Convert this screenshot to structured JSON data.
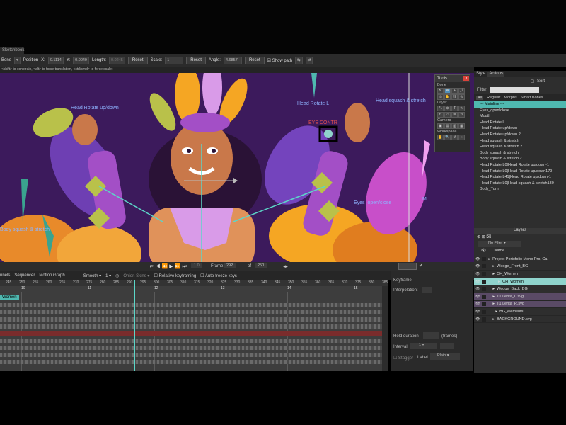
{
  "window": {
    "doc_tab": "Sketchbook"
  },
  "tool_options": {
    "tool": "Bone",
    "position_label": "Position",
    "x_label": "X:",
    "x_value": "0.1114",
    "y_label": "Y:",
    "y_value": "0.0049",
    "length_label": "Length:",
    "length_value": "0.0245",
    "reset1": "Reset",
    "scale_label": "Scale:",
    "scale_value": "1",
    "reset2": "Reset",
    "angle_label": "Angle:",
    "angle_value": "4.6857",
    "reset3": "Reset",
    "show_path": "Show path"
  },
  "hint": "<shift> to constrain, <alt> to force translation, <ctrl/cmd> to force scale)",
  "canvas": {
    "labels": {
      "head_rotate_updown": "Head Rotate up/down",
      "head_rotate_l": "Head Rotate L",
      "head_squash": "Head squash & stretch",
      "eye_control": "EYE CONTR",
      "eyes_open_close": "Eyes_open/close",
      "body_squash": "Body squash & stretch",
      "mi": "Mi"
    }
  },
  "tools_panel": {
    "title": "Tools",
    "close": "x",
    "sections": [
      "Bone",
      "Layer",
      "Camera",
      "Workspace"
    ]
  },
  "timeline": {
    "tabs": [
      "nnels",
      "Sequencer",
      "Motion Graph"
    ],
    "smooth": "Smooth",
    "one": "1",
    "onion": "Onion Skins",
    "relative": "Relative keyframing",
    "autofreeze": "Auto-freeze keys",
    "frame_label": "Frame:",
    "frame_value": "292",
    "of_label": "of",
    "of_value": "250",
    "frame_box": "1.0",
    "ruler": [
      "245",
      "250",
      "255",
      "260",
      "265",
      "270",
      "275",
      "280",
      "285",
      "290",
      "295",
      "300",
      "305",
      "310",
      "315",
      "320",
      "325",
      "330",
      "335",
      "340",
      "345",
      "350",
      "355",
      "360",
      "365",
      "370",
      "375",
      "380",
      "385"
    ],
    "markers": [
      "10",
      "11",
      "12",
      "13",
      "14",
      "15"
    ],
    "channel": "Women"
  },
  "keyframe_panel": {
    "keyframe": "Keyframe:",
    "interpolation": "Interpolation:",
    "hold_duration": "Hold duration",
    "frames": "(frames)",
    "interval": "Interval",
    "interval_value": "1",
    "stagger": "Stagger",
    "label": "Label",
    "label_value": "Plain"
  },
  "right_panel": {
    "tabs": [
      "Style",
      "Actions"
    ],
    "sort": "Sort",
    "filter_label": "Filter:",
    "action_tabs": [
      "All",
      "Regular",
      "Morphs",
      "Smart Bones"
    ],
    "actions": [
      "--- Mainline ---",
      "Eyes_open/close",
      "Mouth",
      "Head Rotate L",
      "Head Rotate up/down",
      "Head Rotate up/down 2",
      "Head squash & stretch",
      "Head squash & stretch 2",
      "Body squash & stretch",
      "Body squash & stretch 2",
      "Head Rotate L0|Head Rotate up/down-1",
      "Head Rotate L0|Head Rotate up/down179",
      "Head Rotate L41|Head Rotate up/down-1",
      "Head Rotate L0|Head squash & stretch130",
      "Body_Turn"
    ],
    "layers_title": "Layers",
    "no_filter": "No Filter",
    "name_col": "Name",
    "layers": [
      "Project Portofolio Moho Pro, Ca",
      "Wedge_Front_BG",
      "CH_Women",
      "CH_Women",
      "Wedge_Back_BG",
      "T1 Lenta_L.svg",
      "T1 Lenta_R.svg",
      "BG_elements",
      "BACKGROUND.svg"
    ]
  },
  "colors": {
    "accent": "#4fb8b0",
    "canvas_bg": "#3c1a5c",
    "selection": "#8fd3cc"
  }
}
